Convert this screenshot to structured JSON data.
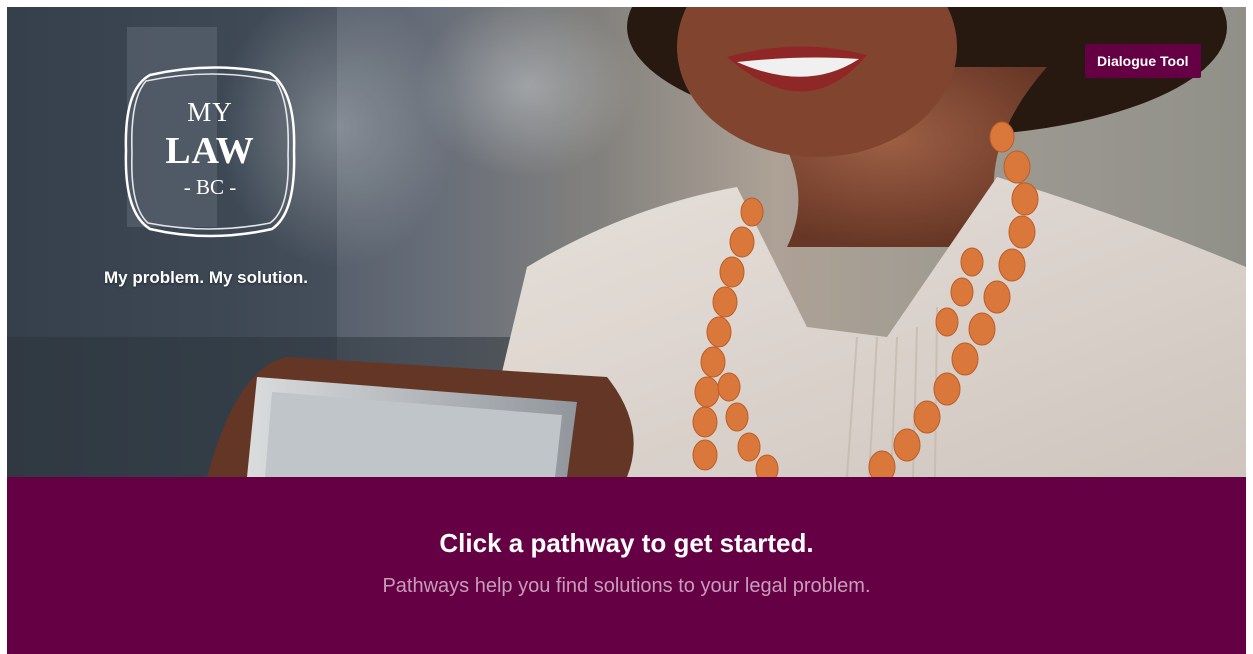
{
  "header": {
    "dialogue_tool_label": "Dialogue Tool"
  },
  "logo": {
    "line1": "MY",
    "line2": "LAW",
    "line3": "- BC -"
  },
  "hero": {
    "tagline": "My problem. My solution."
  },
  "banner": {
    "title": "Click a pathway to get started.",
    "subtitle": "Pathways help you find solutions to your legal problem."
  },
  "colors": {
    "brand": "#660044",
    "subtitle": "#c79dba",
    "necklace": "#e8803f"
  }
}
